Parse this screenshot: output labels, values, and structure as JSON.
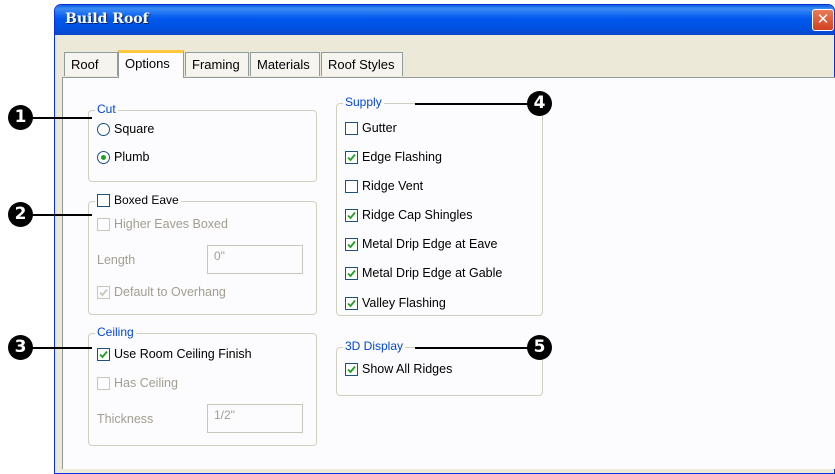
{
  "window": {
    "title": "Build Roof",
    "close_glyph": "✕"
  },
  "tabs": [
    {
      "label": "Roof",
      "active": false
    },
    {
      "label": "Options",
      "active": true
    },
    {
      "label": "Framing",
      "active": false
    },
    {
      "label": "Materials",
      "active": false
    },
    {
      "label": "Roof Styles",
      "active": false
    }
  ],
  "cut": {
    "legend": "Cut",
    "options": [
      {
        "label": "Square",
        "selected": false
      },
      {
        "label": "Plumb",
        "selected": true
      }
    ]
  },
  "boxed_eave": {
    "label": "Boxed Eave",
    "checked": false,
    "higher_eaves": {
      "label": "Higher Eaves Boxed",
      "checked": false,
      "enabled": false
    },
    "length": {
      "label": "Length",
      "value": "0\""
    },
    "default_overhang": {
      "label": "Default to Overhang",
      "checked": true,
      "enabled": false
    }
  },
  "ceiling": {
    "legend": "Ceiling",
    "use_room_finish": {
      "label": "Use Room Ceiling Finish",
      "checked": true
    },
    "has_ceiling": {
      "label": "Has Ceiling",
      "checked": false,
      "enabled": false
    },
    "thickness": {
      "label": "Thickness",
      "value": "1/2\""
    }
  },
  "supply": {
    "legend": "Supply",
    "items": [
      {
        "label": "Gutter",
        "checked": false
      },
      {
        "label": "Edge Flashing",
        "checked": true
      },
      {
        "label": "Ridge Vent",
        "checked": false
      },
      {
        "label": "Ridge Cap Shingles",
        "checked": true
      },
      {
        "label": "Metal Drip Edge at Eave",
        "checked": true
      },
      {
        "label": "Metal Drip Edge at Gable",
        "checked": true
      },
      {
        "label": "Valley Flashing",
        "checked": true
      }
    ]
  },
  "display3d": {
    "legend": "3D Display",
    "show_all_ridges": {
      "label": "Show All Ridges",
      "checked": true
    }
  },
  "callouts": [
    "1",
    "2",
    "3",
    "4",
    "5"
  ],
  "colors": {
    "titlebar": "#0058ee",
    "legend_text": "#0046d5",
    "check_mark": "#21a121",
    "tab_highlight": "#ffc83c"
  }
}
